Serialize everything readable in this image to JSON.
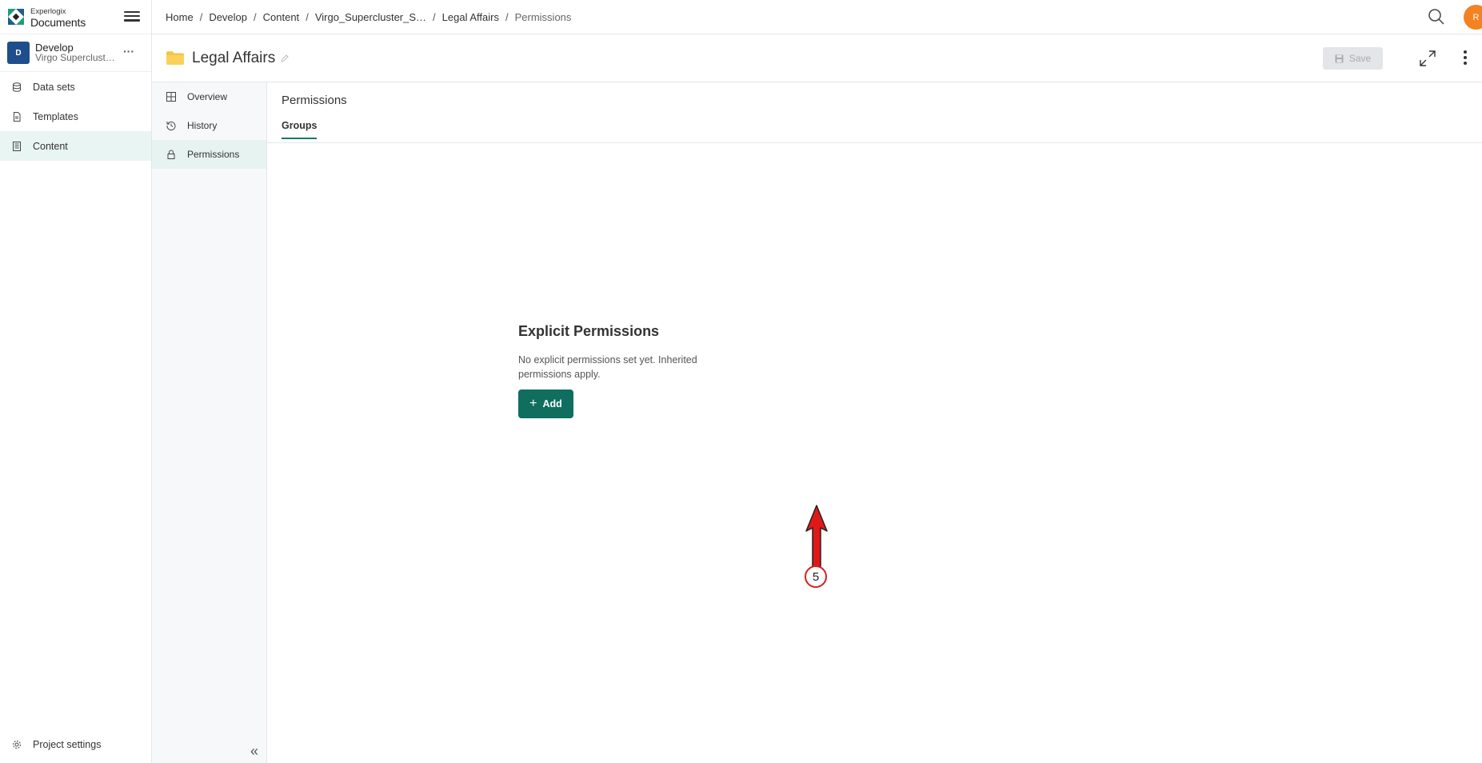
{
  "brand": {
    "small": "Experlogix",
    "big": "Documents"
  },
  "project": {
    "badge": "D",
    "name": "Develop",
    "subtitle": "Virgo Superclust…",
    "more": "···"
  },
  "sidebar": {
    "items": [
      {
        "label": "Data sets",
        "icon": "database-icon"
      },
      {
        "label": "Templates",
        "icon": "document-icon"
      },
      {
        "label": "Content",
        "icon": "content-icon",
        "active": true
      }
    ],
    "bottom": {
      "label": "Project settings",
      "icon": "gear-icon"
    }
  },
  "breadcrumb": [
    "Home",
    "Develop",
    "Content",
    "Virgo_Supercluster_S…",
    "Legal Affairs",
    "Permissions"
  ],
  "user": {
    "initial": "R",
    "color": "#f58220"
  },
  "header": {
    "title": "Legal Affairs",
    "save_label": "Save"
  },
  "subnav": {
    "items": [
      {
        "label": "Overview",
        "icon": "grid-icon"
      },
      {
        "label": "History",
        "icon": "history-icon"
      },
      {
        "label": "Permissions",
        "icon": "lock-icon",
        "active": true
      }
    ],
    "collapse": "«"
  },
  "main": {
    "section_title": "Permissions",
    "tab": "Groups",
    "empty_title": "Explicit Permissions",
    "empty_text": "No explicit permissions set yet. Inherited permissions apply.",
    "add_label": "Add"
  },
  "annotation": {
    "step": "5"
  },
  "colors": {
    "accent": "#0f6e5e",
    "active_bg": "#e9f5f2",
    "project_badge": "#1f4e8c",
    "annotation": "#d61f1f"
  }
}
